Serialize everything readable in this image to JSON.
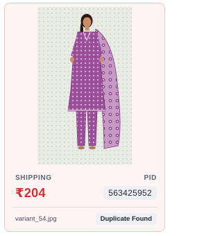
{
  "card": {
    "shipping_label": "SHIPPING",
    "pid_label": "PID",
    "price": "₹204",
    "pid_value": "563425952",
    "filename": "variant_54.jpg",
    "status_badge": "Duplicate Found"
  },
  "colors": {
    "card_background": "#fdf4f3",
    "card_border": "#f1c4c0",
    "price": "#d32f2f",
    "badge_background": "#eef0f6",
    "garment": "#9b4f9a"
  },
  "image": {
    "subject": "product-photo-kurta-set"
  }
}
